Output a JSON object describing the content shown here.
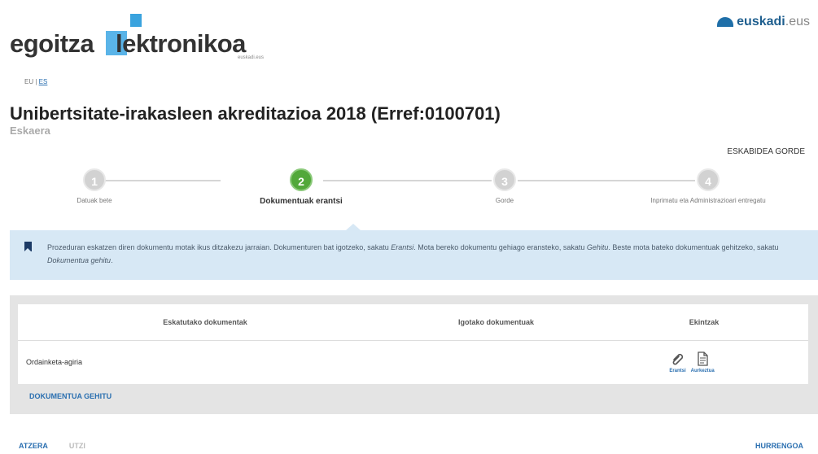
{
  "header": {
    "logo_part1": "egoitza",
    "logo_part2": "lektronikoa",
    "logo_sub": "euskadi.eus",
    "brand_name": "euskadi",
    "brand_suffix": ".eus",
    "brand_icon": "euskadi-logo-icon"
  },
  "language": {
    "current": "EU",
    "separator": " | ",
    "other": "ES"
  },
  "page": {
    "title": "Unibertsitate-irakasleen akreditazioa 2018 (Erref:0100701)",
    "subtitle": "Eskaera",
    "save_label": "ESKABIDEA GORDE"
  },
  "steps": [
    {
      "number": "1",
      "label": "Datuak bete",
      "active": false
    },
    {
      "number": "2",
      "label": "Dokumentuak erantsi",
      "active": true
    },
    {
      "number": "3",
      "label": "Gorde",
      "active": false
    },
    {
      "number": "4",
      "label": "Inprimatu eta Administrazioari entregatu",
      "active": false
    }
  ],
  "info": {
    "icon": "bookmark-icon",
    "text1": "Prozeduran eskatzen diren dokumentu motak ikus ditzakezu jarraian. Dokumenturen bat igotzeko, sakatu ",
    "link1": "Erantsi",
    "text2": ". Mota bereko dokumentu gehiago eransteko, sakatu ",
    "link2": "Gehitu",
    "text3": ". Beste mota bateko dokumentuak gehitzeko, sakatu ",
    "link3": "Dokumentua gehitu",
    "text4": "."
  },
  "table": {
    "headers": [
      "Eskatutako dokumentak",
      "Igotako dokumentuak",
      "Ekintzak"
    ],
    "rows": [
      {
        "name": "Ordainketa-agiria",
        "uploaded": "",
        "actions": [
          "Erantsi",
          "Aurkeztua"
        ]
      }
    ],
    "add_label": "DOKUMENTUA GEHITU"
  },
  "footer": {
    "back": "ATZERA",
    "exit": "UTZI",
    "next": "HURRENGOA"
  },
  "colors": {
    "active_step": "#52a83a",
    "link": "#2a6fb0",
    "info_bg": "#d7e8f5"
  }
}
